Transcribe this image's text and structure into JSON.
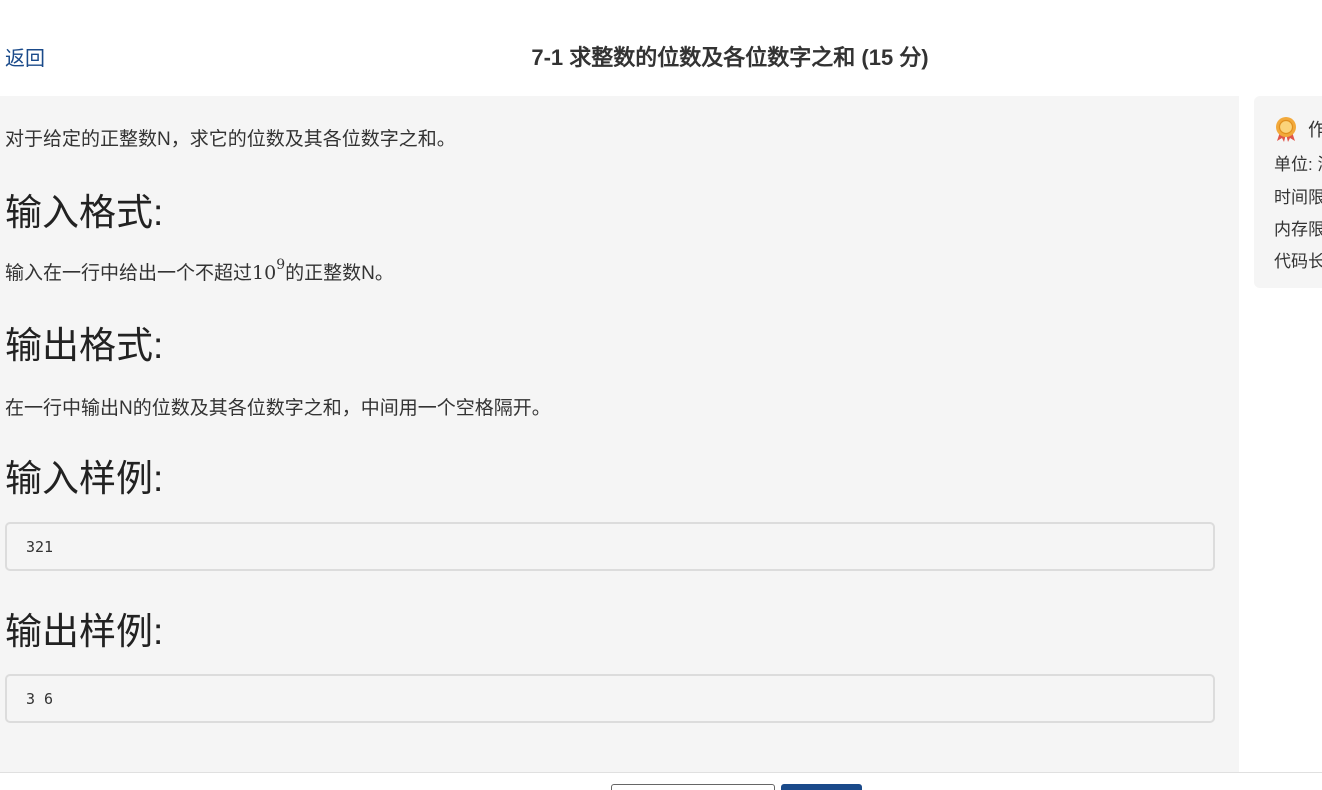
{
  "header": {
    "back_label": "返回",
    "title": "7-1 求整数的位数及各位数字之和 (15 分)"
  },
  "problem": {
    "intro": "对于给定的正整数N，求它的位数及其各位数字之和。",
    "input_format_heading": "输入格式:",
    "input_format_before": "输入在一行中给出一个不超过",
    "input_format_base": "10",
    "input_format_exp": "9",
    "input_format_after": "的正整数N。",
    "output_format_heading": "输出格式:",
    "output_format_text": "在一行中输出N的位数及其各位数字之和，中间用一个空格隔开。",
    "sample_input_heading": "输入样例:",
    "sample_input": "321",
    "sample_output_heading": "输出样例:",
    "sample_output": "3 6"
  },
  "sidebar": {
    "title": "作",
    "unit": "单位: 浙",
    "time_limit": "时间限",
    "memory_limit": "内存限",
    "code_length": "代码长"
  },
  "colors": {
    "accent": "#1a4a8a",
    "panel_bg": "#f5f5f5"
  }
}
